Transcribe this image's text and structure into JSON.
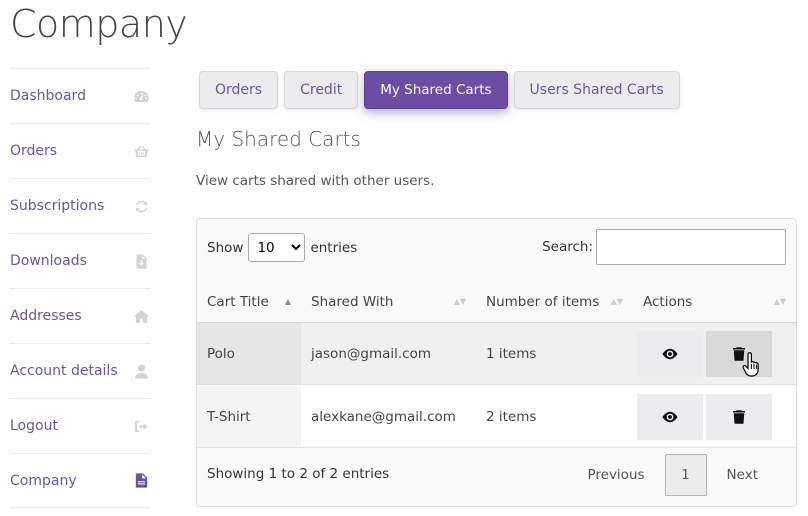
{
  "page": {
    "title": "Company"
  },
  "sidebar": {
    "items": [
      {
        "label": "Dashboard",
        "icon": "dashboard-icon"
      },
      {
        "label": "Orders",
        "icon": "basket-icon"
      },
      {
        "label": "Subscriptions",
        "icon": "refresh-icon"
      },
      {
        "label": "Downloads",
        "icon": "file-download-icon"
      },
      {
        "label": "Addresses",
        "icon": "home-icon"
      },
      {
        "label": "Account details",
        "icon": "user-icon"
      },
      {
        "label": "Logout",
        "icon": "sign-out-icon"
      },
      {
        "label": "Company",
        "icon": "document-icon",
        "active": true
      }
    ]
  },
  "tabs": [
    {
      "label": "Orders"
    },
    {
      "label": "Credit"
    },
    {
      "label": "My Shared Carts",
      "active": true
    },
    {
      "label": "Users Shared Carts"
    }
  ],
  "section": {
    "title": "My Shared Carts",
    "description": "View carts shared with other users."
  },
  "table": {
    "show_label": "Show",
    "entries_label": "entries",
    "page_length": "10",
    "search_label": "Search:",
    "search_value": "",
    "columns": [
      "Cart Title",
      "Shared With",
      "Number of items",
      "Actions"
    ],
    "rows": [
      {
        "title": "Polo",
        "shared_with": "jason@gmail.com",
        "items": "1 items"
      },
      {
        "title": "T-Shirt",
        "shared_with": "alexkane@gmail.com",
        "items": "2 items"
      }
    ],
    "info": "Showing 1 to 2 of 2 entries",
    "pagination": {
      "previous": "Previous",
      "current": "1",
      "next": "Next"
    }
  },
  "colors": {
    "accent": "#6b4ea3",
    "link": "#6b55a0"
  }
}
